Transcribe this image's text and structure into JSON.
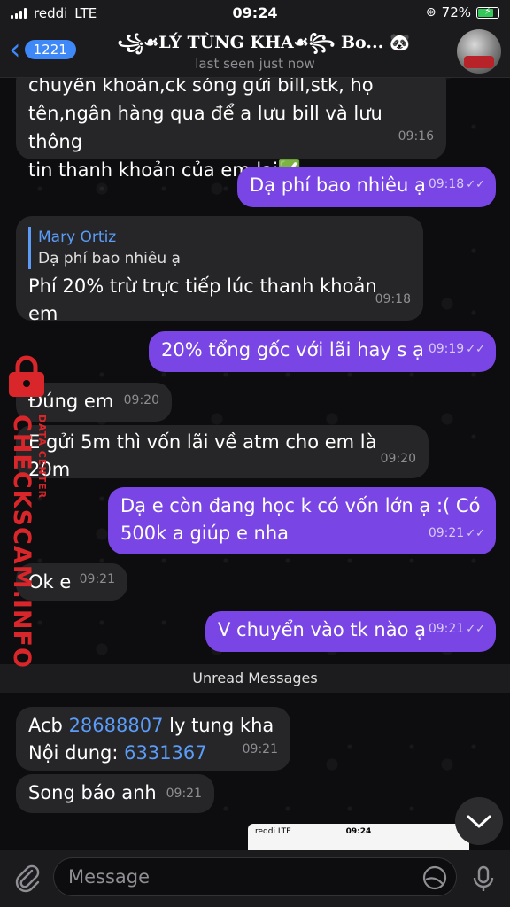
{
  "status_bar": {
    "carrier": "reddi",
    "network": "LTE",
    "time": "09:24",
    "battery": "72%"
  },
  "header": {
    "back_count": "1221",
    "title": "꧁☙LÝ TÙNG KHA☙꧂ Bo...",
    "title_emoji": "🐼",
    "subtitle": "last seen just now"
  },
  "messages": [
    {
      "dir": "in",
      "lines": [
        "chuyển khoản,ck sóng gửi bill,stk, họ",
        "tên,ngân hàng qua để a lưu bill và lưu thông",
        "tin thanh khoản của em lại✅"
      ],
      "time": "09:16"
    },
    {
      "dir": "out",
      "text": "Dạ phí bao nhiêu ạ",
      "time": "09:18"
    },
    {
      "dir": "in",
      "reply_name": "Mary Ortiz",
      "reply_text": "Dạ phí bao nhiêu ạ",
      "text": "Phí 20% trừ trực tiếp lúc thanh khoản em",
      "time": "09:18"
    },
    {
      "dir": "out",
      "text": "20% tổng gốc với lãi hay s ạ",
      "time": "09:19"
    },
    {
      "dir": "in",
      "text": "Đúng em",
      "time": "09:20"
    },
    {
      "dir": "in",
      "text": "E gửi 5m thì vốn lãi về atm cho em là 20m",
      "time": "09:20"
    },
    {
      "dir": "out",
      "lines": [
        "Dạ e còn đang học k có vốn lớn ạ :( Có",
        "500k a giúp e nha"
      ],
      "time": "09:21"
    },
    {
      "dir": "in",
      "text": "Ok e",
      "time": "09:21"
    },
    {
      "dir": "out",
      "text": "V chuyển vào tk nào ạ",
      "time": "09:21"
    },
    {
      "dir": "in",
      "line1_prefix": "Acb ",
      "line1_link": "28688807",
      "line1_suffix": " ly tung kha",
      "line2_prefix": "Nội dung: ",
      "line2_link": "6331367",
      "time": "09:21"
    },
    {
      "dir": "in",
      "text": "Song báo anh",
      "time": "09:21"
    }
  ],
  "unread_label": "Unread Messages",
  "preview": {
    "carrier": "reddi",
    "network": "LTE",
    "time": "09:24"
  },
  "watermark": {
    "main": "CHECKSCAM.INFO",
    "sub": "DATA CENTER"
  },
  "input": {
    "placeholder": "Message"
  },
  "colors": {
    "accent": "#3e88f7",
    "outgoing": "#7a45e5",
    "incoming": "#262628",
    "watermark": "#d8262a"
  },
  "icons": [
    "back-chevron-icon",
    "paperclip-icon",
    "sticker-icon",
    "microphone-icon",
    "chevron-down-icon",
    "lock-icon",
    "battery-icon",
    "signal-icon"
  ]
}
